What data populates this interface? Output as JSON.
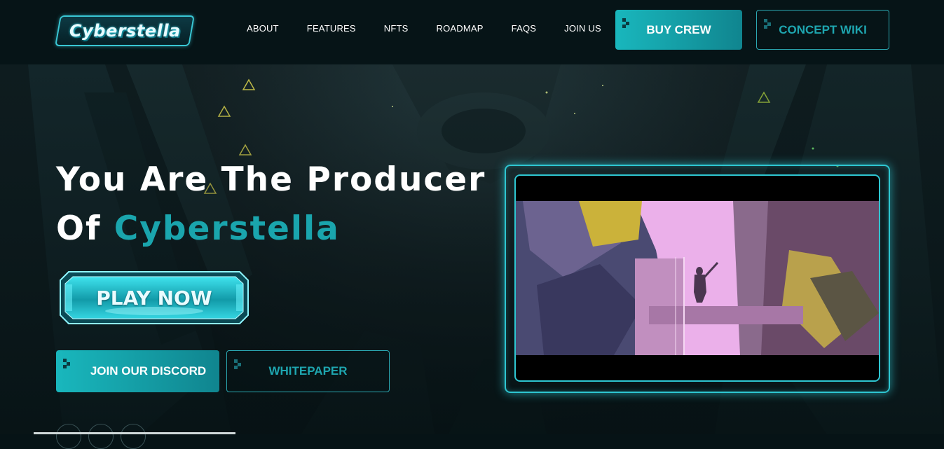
{
  "header": {
    "logo_text": "Cyberstella",
    "nav": [
      "ABOUT",
      "FEATURES",
      "NFTS",
      "ROADMAP",
      "FAQS",
      "JOIN US"
    ],
    "buy_label": "BUY CREW",
    "wiki_label": "CONCEPT WIKI"
  },
  "hero": {
    "title_line1": "You Are The Producer",
    "title_line2_prefix": "Of ",
    "title_line2_accent": "Cyberstella",
    "play_label": "PLAY NOW",
    "discord_label": "JOIN OUR DISCORD",
    "whitepaper_label": "WHITEPAPER"
  },
  "colors": {
    "accent": "#1aa5ad",
    "button_gradient_start": "#19b7bd",
    "button_gradient_end": "#10858f",
    "background": "#061316",
    "video_pink": "#e9a8e8"
  }
}
